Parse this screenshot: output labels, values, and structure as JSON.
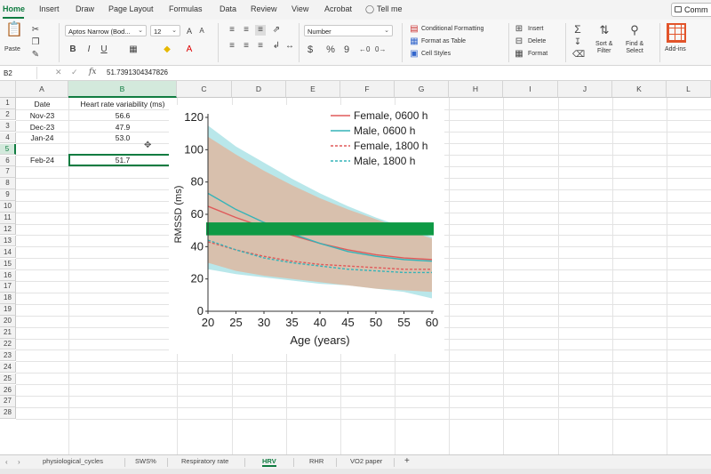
{
  "ribbon_tabs": [
    "Home",
    "Insert",
    "Draw",
    "Page Layout",
    "Formulas",
    "Data",
    "Review",
    "View",
    "Acrobat",
    "Tell me"
  ],
  "comments_label": "Comm",
  "clipboard": {
    "paste_label": "Paste"
  },
  "font": {
    "name": "Aptos Narrow (Bod...",
    "size": "12",
    "bold": "B",
    "italic": "I",
    "underline": "U"
  },
  "number_format": "Number",
  "number_buttons": {
    "currency": "$",
    "percent": "%",
    "comma": "9"
  },
  "styles": {
    "conditional": "Conditional Formatting",
    "table": "Format as Table",
    "cell_styles": "Cell Styles"
  },
  "cells_group": {
    "insert": "Insert",
    "delete": "Delete",
    "format": "Format"
  },
  "editing": {
    "sort": "Sort &\nFilter",
    "find": "Find &\nSelect"
  },
  "addins_label": "Add-ins",
  "name_box": "B2",
  "formula_value": "51.7391304347826",
  "fx_label": "fx",
  "columns": [
    "A",
    "B",
    "C",
    "D",
    "E",
    "F",
    "G",
    "H",
    "I",
    "J",
    "K",
    "L"
  ],
  "rows": [
    "1",
    "2",
    "3",
    "4",
    "5",
    "6",
    "7",
    "8",
    "9",
    "10",
    "11",
    "12",
    "13",
    "14",
    "15",
    "16",
    "17",
    "18",
    "19",
    "20",
    "21",
    "22",
    "23",
    "24",
    "25",
    "26",
    "27",
    "28"
  ],
  "table": {
    "headers": [
      "Date",
      "Heart rate variability (ms)"
    ],
    "rows": [
      [
        "Nov-23",
        "56.6"
      ],
      [
        "Dec-23",
        "47.9"
      ],
      [
        "Jan-24",
        "53.0"
      ],
      [
        "Feb-24",
        "51.7"
      ]
    ]
  },
  "sheet_tabs": [
    "physiological_cycles",
    "SWS%",
    "Respiratory rate",
    "HRV",
    "RHR",
    "VO2 paper"
  ],
  "active_sheet": "HRV",
  "add_sheet_label": "+",
  "colors": {
    "accent": "#107c41",
    "female": "#e05a5a",
    "male": "#35b3b8",
    "band": "#0e9a45"
  },
  "chart_data": {
    "type": "line",
    "xlabel": "Age (years)",
    "ylabel": "RMSSD (ms)",
    "x": [
      20,
      25,
      30,
      35,
      40,
      45,
      50,
      55,
      60
    ],
    "xlim": [
      20,
      60
    ],
    "ylim": [
      0,
      120
    ],
    "xticks": [
      "20",
      "25",
      "30",
      "35",
      "40",
      "45",
      "50",
      "55",
      "60"
    ],
    "yticks": [
      "0",
      "20",
      "40",
      "60",
      "80",
      "100",
      "120"
    ],
    "grid": false,
    "legend_position": "top-right",
    "series": [
      {
        "name": "Female, 0600 h",
        "style": "solid",
        "color": "#e05a5a",
        "values": [
          65,
          58,
          52,
          47,
          42,
          38,
          35,
          33,
          32
        ]
      },
      {
        "name": "Male, 0600 h",
        "style": "solid",
        "color": "#35b3b8",
        "values": [
          73,
          63,
          55,
          48,
          42,
          37,
          34,
          32,
          31
        ]
      },
      {
        "name": "Female, 1800 h",
        "style": "dashed",
        "color": "#e05a5a",
        "values": [
          43,
          38,
          34,
          31,
          29,
          28,
          27,
          26,
          26
        ]
      },
      {
        "name": "Male, 1800 h",
        "style": "dashed",
        "color": "#35b3b8",
        "values": [
          44,
          38,
          33,
          30,
          28,
          26,
          25,
          24,
          24
        ]
      }
    ],
    "bands": [
      {
        "name": "Male, 0600 h",
        "color": "#7fd3d8",
        "upper": [
          115,
          102,
          92,
          82,
          73,
          65,
          58,
          52,
          46
        ],
        "lower": [
          26,
          23,
          21,
          19,
          17,
          16,
          14,
          12,
          8
        ]
      },
      {
        "name": "Female, 0600 h",
        "color": "#f2a07a",
        "upper": [
          108,
          97,
          87,
          78,
          70,
          63,
          57,
          51,
          45
        ],
        "lower": [
          30,
          25,
          22,
          20,
          18,
          16,
          14,
          13,
          12
        ]
      }
    ],
    "highlight_band": {
      "color": "#0e9a45",
      "y_range": [
        47,
        55
      ]
    }
  }
}
